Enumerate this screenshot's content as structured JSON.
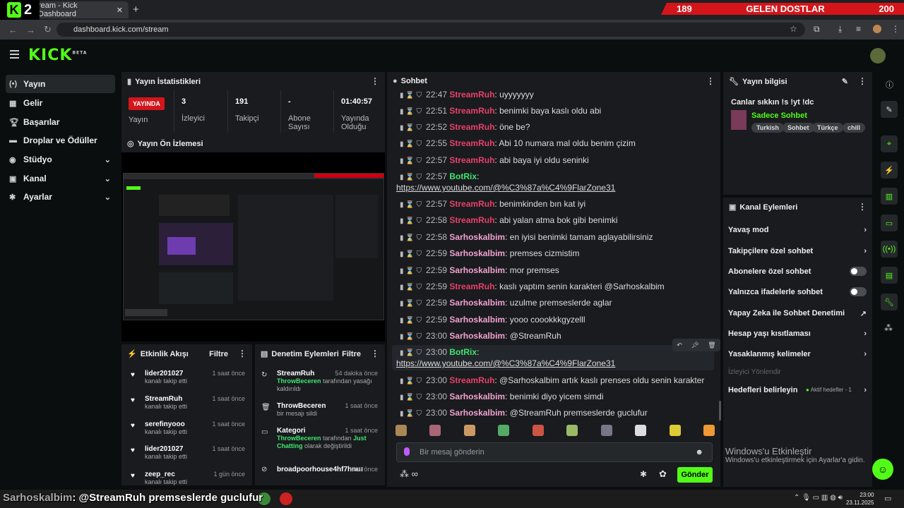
{
  "browser": {
    "tab_title": "ream - Kick Dashboard",
    "url": "dashboard.kick.com/stream",
    "overlay_logo": "2"
  },
  "banner": {
    "left": "189",
    "center": "GELEN DOSTLAR",
    "right": "200"
  },
  "nav": [
    {
      "label": "Yayın",
      "icon": "broadcast-icon",
      "active": true
    },
    {
      "label": "Gelir",
      "icon": "chart-icon"
    },
    {
      "label": "Başarılar",
      "icon": "trophy-icon"
    },
    {
      "label": "Droplar ve Ödüller",
      "icon": "gift-icon"
    },
    {
      "label": "Stüdyo",
      "icon": "studio-icon",
      "chevron": true
    },
    {
      "label": "Kanal",
      "icon": "channel-icon",
      "chevron": true
    },
    {
      "label": "Ayarlar",
      "icon": "gear-icon",
      "chevron": true
    }
  ],
  "stats": {
    "title": "Yayın İstatistikleri",
    "live_badge": "YAYINDA",
    "live_label": "Yayın",
    "viewers": "3",
    "viewers_label": "İzleyici",
    "followers": "191",
    "followers_label": "Takipçi",
    "subs": "-",
    "subs_label": "Abone Sayısı",
    "uptime": "01:40:57",
    "uptime_label": "Yayında Olduğu"
  },
  "preview": {
    "title": "Yayın Ön İzlemesi"
  },
  "activity": {
    "title": "Etkinlik Akışı",
    "filter": "Filtre",
    "items": [
      {
        "user": "lider201027",
        "sub": "kanalı takip etti",
        "time": "1 saat önce"
      },
      {
        "user": "StreamRuh",
        "sub": "kanalı takip etti",
        "time": "1 saat önce"
      },
      {
        "user": "serefinyooo",
        "sub": "kanalı takip etti",
        "time": "1 saat önce"
      },
      {
        "user": "lider201027",
        "sub": "kanalı takip etti",
        "time": "1 saat önce"
      },
      {
        "user": "zeep_rec",
        "sub": "kanalı takip etti",
        "time": "1 gün önce"
      }
    ]
  },
  "moderation": {
    "title": "Denetim Eylemleri",
    "filter": "Filtre",
    "items": [
      {
        "user": "StreamRuh",
        "by": "ThrowBeceren",
        "sub": "tarafından yasağı kaldırıldı",
        "time": "54 dakika önce"
      },
      {
        "user": "ThrowBeceren",
        "sub": "bir mesajı sildi",
        "time": "1 saat önce"
      },
      {
        "user": "Kategori",
        "by": "ThrowBeceren",
        "sub": "tarafından",
        "sub2": "Just Chatting",
        "sub3": "olarak değiştirildi",
        "time": "1 saat önce"
      },
      {
        "user": "broadpoorhouse4hf7hnuap",
        "time": "saat önce"
      }
    ]
  },
  "chat": {
    "title": "Sohbet",
    "placeholder": "Bir mesaj gönderin",
    "send": "Gönder",
    "messages": [
      {
        "time": "22:47",
        "user": "StreamRuh",
        "color": "red",
        "text": "uyyyyyyy"
      },
      {
        "time": "22:51",
        "user": "StreamRuh",
        "color": "red",
        "text": "benimki baya kaslı oldu abi"
      },
      {
        "time": "22:52",
        "user": "StreamRuh",
        "color": "red",
        "text": "öne be?"
      },
      {
        "time": "22:55",
        "user": "StreamRuh",
        "color": "red",
        "text": "Abi 10 numara mal oldu benim çizim"
      },
      {
        "time": "22:57",
        "user": "StreamRuh",
        "color": "red",
        "text": "abi baya iyi oldu seninki"
      },
      {
        "time": "22:57",
        "user": "BotRix",
        "color": "green",
        "text": "",
        "link": "https://www.youtube.com/@%C3%87a%C4%9FlarZone31"
      },
      {
        "time": "22:57",
        "user": "StreamRuh",
        "color": "red",
        "text": "benimkinden bın kat iyi"
      },
      {
        "time": "22:58",
        "user": "StreamRuh",
        "color": "red",
        "text": "abi yalan atma bok gibi benimki"
      },
      {
        "time": "22:58",
        "user": "Sarhoskalbim",
        "color": "pink",
        "text": "en iyisi benimki tamam aglayabilirsiniz"
      },
      {
        "time": "22:59",
        "user": "Sarhoskalbim",
        "color": "pink",
        "text": "premses cizmistim"
      },
      {
        "time": "22:59",
        "user": "Sarhoskalbim",
        "color": "pink",
        "text": "mor premses"
      },
      {
        "time": "22:59",
        "user": "StreamRuh",
        "color": "red",
        "text": "kaslı yaptım senin karakteri @Sarhoskalbim"
      },
      {
        "time": "22:59",
        "user": "Sarhoskalbim",
        "color": "pink",
        "text": "uzulme premseslerde aglar"
      },
      {
        "time": "22:59",
        "user": "Sarhoskalbim",
        "color": "pink",
        "text": "yooo coookkkgyzelll"
      },
      {
        "time": "23:00",
        "user": "Sarhoskalbim",
        "color": "pink",
        "text": "@StreamRuh"
      },
      {
        "time": "23:00",
        "user": "BotRix",
        "color": "green",
        "text": "",
        "link": "https://www.youtube.com/@%C3%87a%C4%9FlarZone31"
      },
      {
        "time": "23:00",
        "user": "StreamRuh",
        "color": "red",
        "text": "@Sarhoskalbim artık kaslı prenses oldu senin karakter"
      },
      {
        "time": "23:00",
        "user": "Sarhoskalbim",
        "color": "pink",
        "text": "benimki diyo yicem simdi"
      },
      {
        "time": "23:00",
        "user": "Sarhoskalbim",
        "color": "pink",
        "text": "@StreamRuh premseslerde guclufur"
      }
    ]
  },
  "info": {
    "title": "Yayın bilgisi",
    "stream_title": "Canlar sıkkın !s !yt !dc",
    "category": "Sadece Sohbet",
    "tags": [
      "Turkish",
      "Sohbet",
      "Türkçe",
      "chill"
    ]
  },
  "channel_actions": {
    "title": "Kanal Eylemleri",
    "rows": [
      {
        "label": "Yavaş mod",
        "type": "arrow"
      },
      {
        "label": "Takipçilere özel sohbet",
        "type": "arrow"
      },
      {
        "label": "Abonelere özel sohbet",
        "type": "toggle"
      },
      {
        "label": "Yalnızca ifadelerle sohbet",
        "type": "toggle"
      },
      {
        "label": "Yapay Zeka ile Sohbet Denetimi",
        "type": "external"
      },
      {
        "label": "Hesap yaşı kısıtlaması",
        "type": "arrow"
      },
      {
        "label": "Yasaklanmış kelimeler",
        "type": "arrow"
      }
    ],
    "section": "İzleyici Yönlendir",
    "goals_label": "Hedefleri belirleyin",
    "goals_status": "Aktif hedefler - 1"
  },
  "windows": {
    "activate_title": "Windows'u Etkinleştir",
    "activate_sub": "Windows'u etkinleştirmek için Ayarlar'a gidin.",
    "time": "23:00",
    "date": "23.11.2025"
  },
  "subtitle": {
    "user": "Sarhoskalbim",
    "text": ": @StreamRuh premseslerde guclufur"
  },
  "colors": {
    "kick_green": "#53fc18",
    "live_red": "#d4151a",
    "user_red": "#e84168",
    "user_pink": "#f3a2cf",
    "bot_green": "#3ee86e"
  }
}
